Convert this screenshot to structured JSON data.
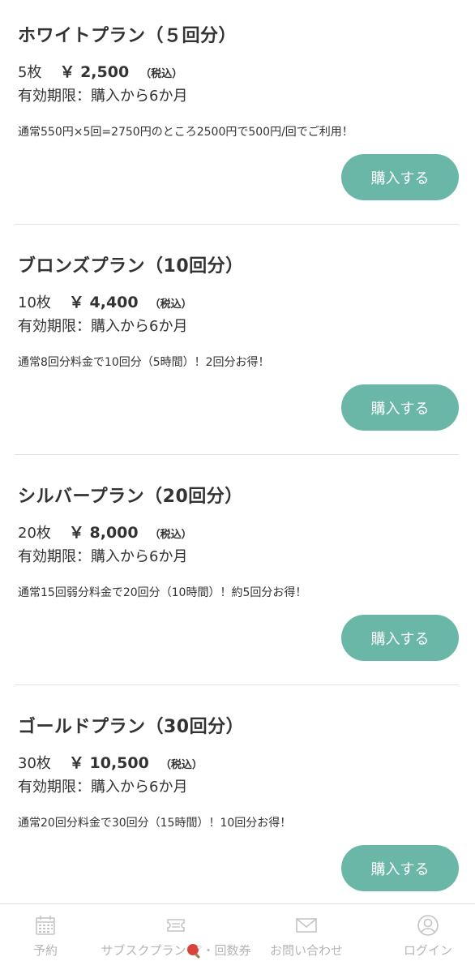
{
  "plans": [
    {
      "title": "ホワイトプラン（５回分）",
      "quantity": "5枚",
      "price": "￥ 2,500",
      "tax": "（税込）",
      "validity": "有効期限：購入から6か月",
      "description": "通常550円×5回=2750円のところ2500円で500円/回でご利用！",
      "button_label": "購入する"
    },
    {
      "title": "ブロンズプラン（10回分）",
      "quantity": "10枚",
      "price": "￥ 4,400",
      "tax": "（税込）",
      "validity": "有効期限：購入から6か月",
      "description": "通常8回分料金で10回分（5時間）！2回分お得！",
      "button_label": "購入する"
    },
    {
      "title": "シルバープラン（20回分）",
      "quantity": "20枚",
      "price": "￥ 8,000",
      "tax": "（税込）",
      "validity": "有効期限：購入から6か月",
      "description": "通常15回弱分料金で20回分（10時間）！約5回分お得！",
      "button_label": "購入する"
    },
    {
      "title": "ゴールドプラン（30回分）",
      "quantity": "30枚",
      "price": "￥ 10,500",
      "tax": "（税込）",
      "validity": "有効期限：購入から6か月",
      "description": "通常20回分料金で30回分（15時間）！10回分お得！",
      "button_label": "購入する"
    }
  ],
  "bottom_nav": {
    "items": [
      {
        "label": "予約",
        "icon": "calendar-icon"
      },
      {
        "label_before": "サブスクプラン",
        "label_after": "・回数券",
        "icon": "ticket-icon",
        "inline_icon": "ping-pong-paddle-icon"
      },
      {
        "label": "お問い合わせ",
        "icon": "mail-icon"
      },
      {
        "label": "ログイン",
        "icon": "user-icon"
      }
    ]
  },
  "colors": {
    "accent": "#6ab7a7",
    "text": "#333333",
    "nav_inactive": "#b5b5b5",
    "divider": "#e2e2e2"
  }
}
